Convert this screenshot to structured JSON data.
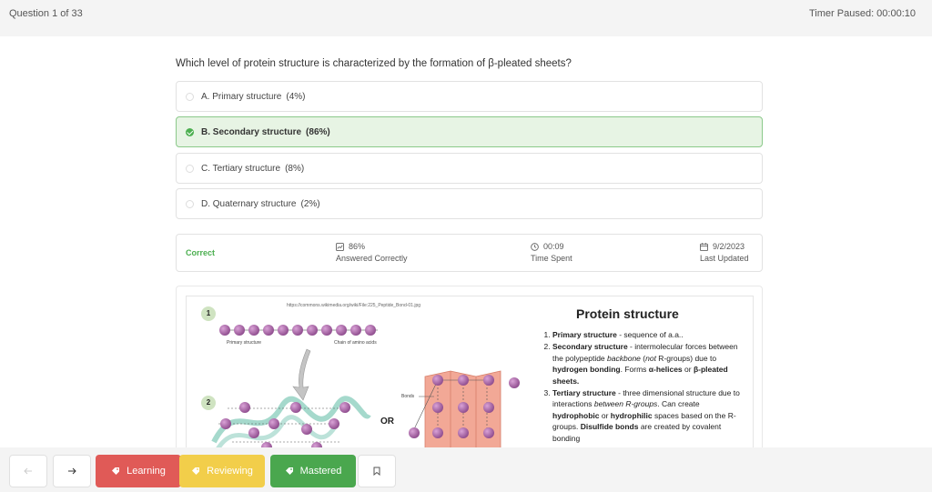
{
  "header": {
    "question_counter": "Question 1 of 33",
    "timer": "Timer Paused: 00:00:10"
  },
  "question": {
    "text": "Which level of protein structure is characterized by the formation of β-pleated sheets?",
    "options": [
      {
        "label": "A. Primary structure",
        "pct": "(4%)",
        "selected": false
      },
      {
        "label": "B. Secondary structure",
        "pct": "(86%)",
        "selected": true
      },
      {
        "label": "C. Tertiary structure",
        "pct": "(8%)",
        "selected": false
      },
      {
        "label": "D. Quaternary structure",
        "pct": "(2%)",
        "selected": false
      }
    ]
  },
  "stats": {
    "result": "Correct",
    "answered_value": "86%",
    "answered_label": "Answered Correctly",
    "time_value": "00:09",
    "time_label": "Time Spent",
    "date_value": "9/2/2023",
    "date_label": "Last Updated"
  },
  "explanation": {
    "source_url": "https://commons.wikimedia.org/wiki/File:225_Peptide_Bond-01.jpg",
    "title": "Protein structure",
    "step1": "1",
    "step2": "2",
    "primary_label": "Primary structure",
    "chain_label": "Chain of amino acids",
    "bonds_label": "Bonds",
    "or": "OR",
    "residue": "AA"
  },
  "toolbar": {
    "back_icon": "arrow-left-icon",
    "next_icon": "arrow-right-icon",
    "learning": "Learning",
    "reviewing": "Reviewing",
    "mastered": "Mastered",
    "bookmark_icon": "bookmark-icon"
  },
  "colors": {
    "correct": "#4caf50",
    "learning": "#e05a57",
    "reviewing": "#f2ce4a",
    "mastered": "#4aa74e"
  }
}
